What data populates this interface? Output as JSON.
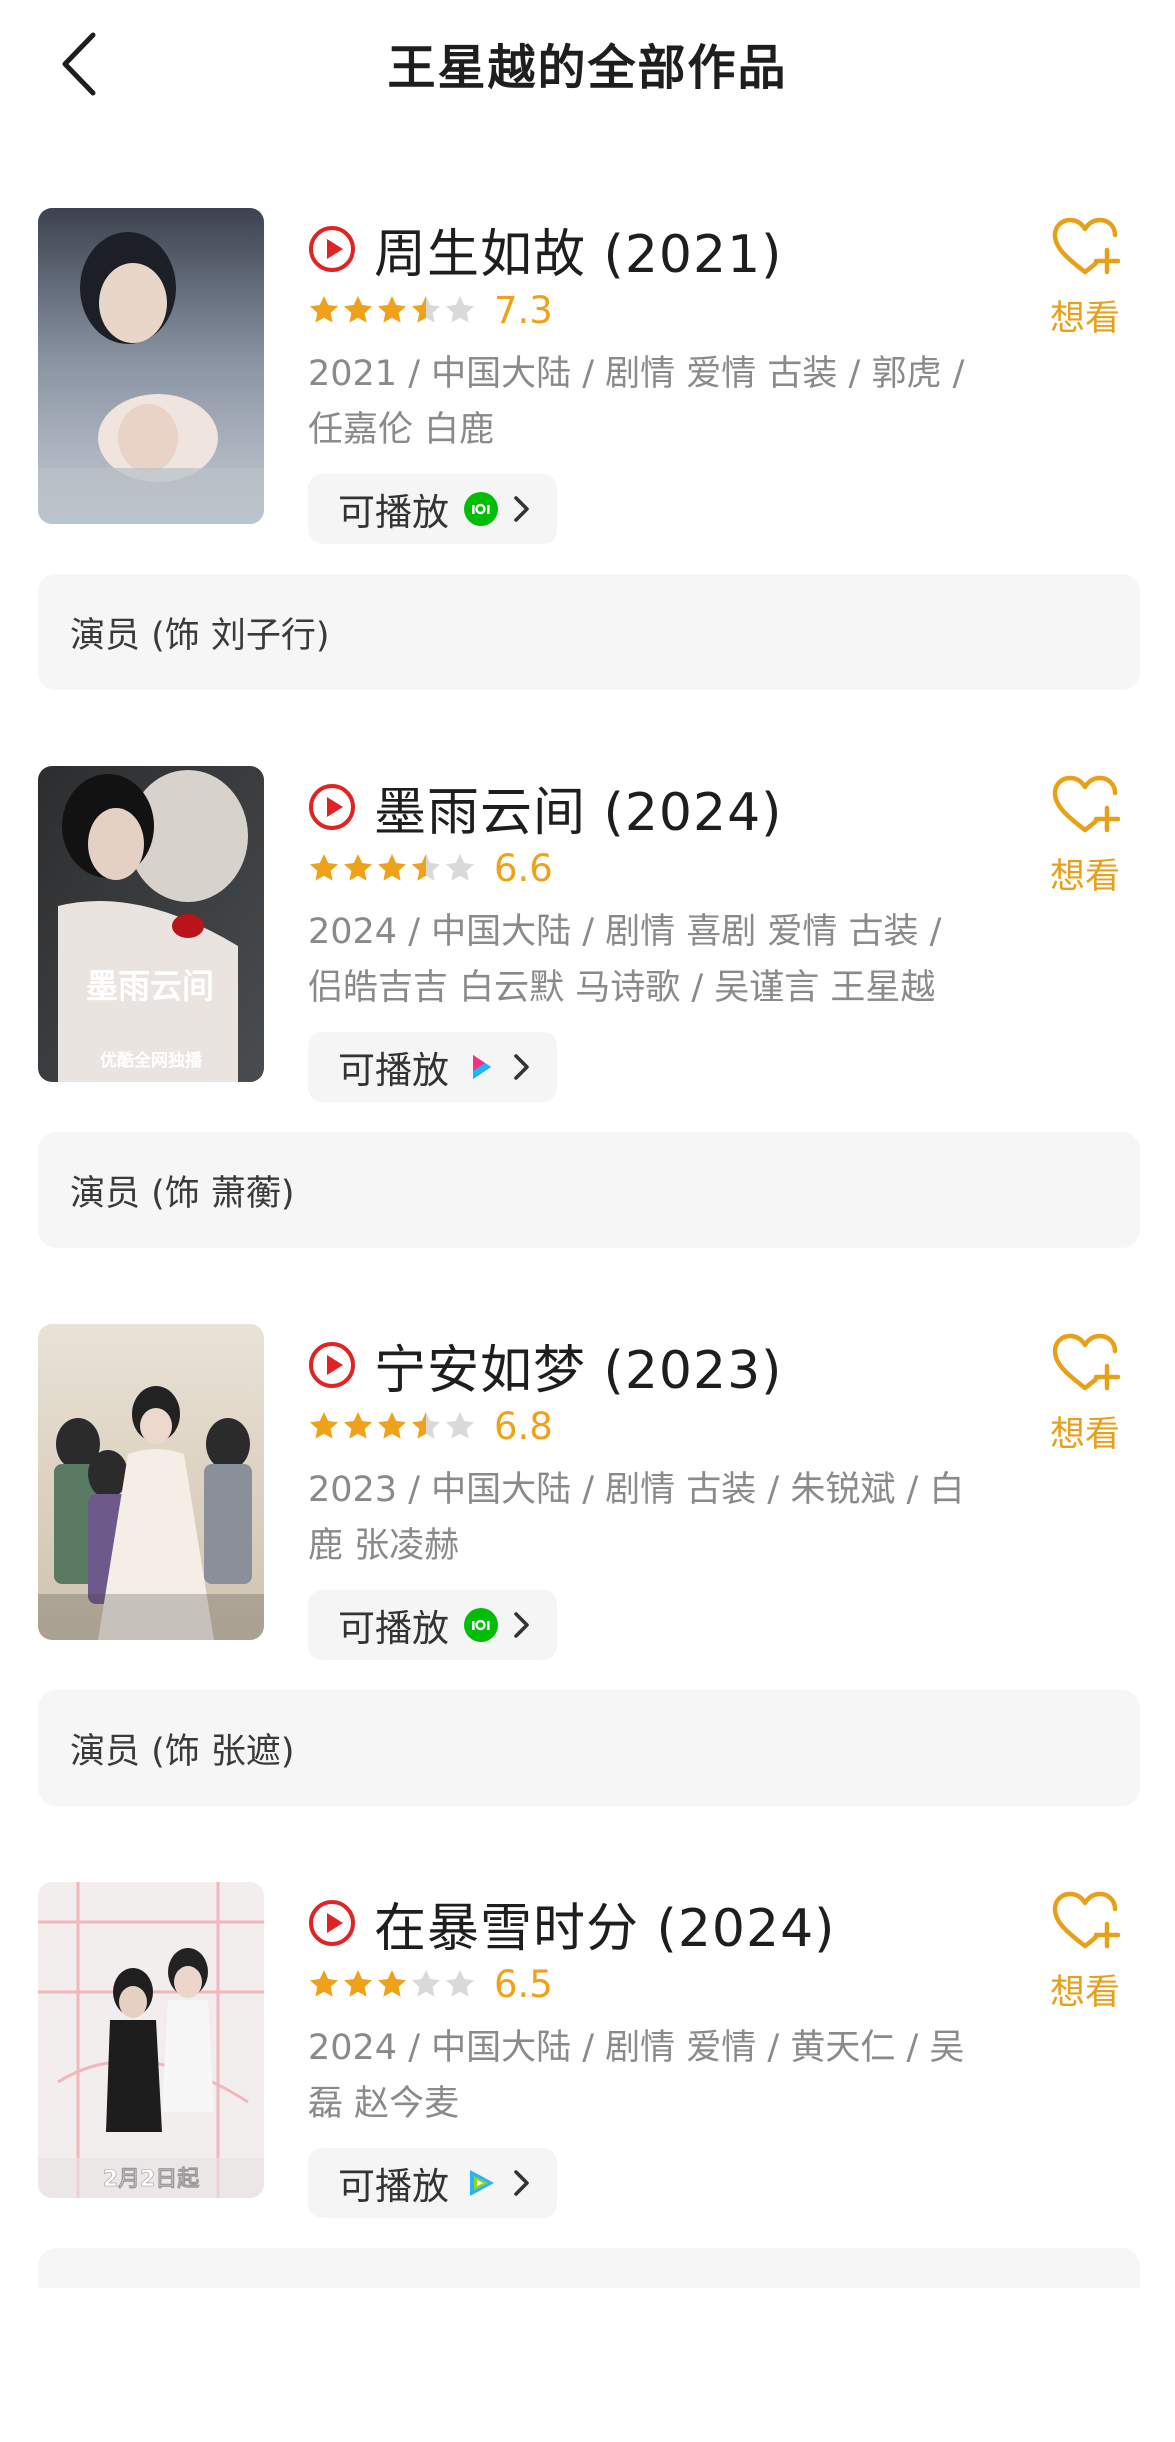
{
  "header": {
    "title": "王星越的全部作品",
    "back_icon": "chevron-left-icon"
  },
  "colors": {
    "accent_orange": "#f0a11a",
    "play_red": "#e02424",
    "star_gray": "#d9d9d9",
    "iqiyi_green": "#00be06"
  },
  "works": [
    {
      "title": "周生如故 (2021)",
      "rating": 7.3,
      "rating_text": "7.3",
      "stars": 3.5,
      "meta": "2021 / 中国大陆 / 剧情 爱情 古装 / 郭虎 / 任嘉伦 白鹿",
      "playable_label": "可播放",
      "platform_icon": "iqiyi-icon",
      "want_label": "想看",
      "role": "演员 (饰 刘子行)"
    },
    {
      "title": "墨雨云间 (2024)",
      "rating": 6.6,
      "rating_text": "6.6",
      "stars": 3.5,
      "meta": "2024 / 中国大陆 / 剧情 喜剧 爱情 古装 / 侣皓吉吉 白云默 马诗歌 / 吴谨言 王星越",
      "playable_label": "可播放",
      "platform_icon": "youku-icon",
      "want_label": "想看",
      "role": "演员 (饰 萧蘅)",
      "poster_text": "墨雨云间",
      "poster_caption": "优酷全网独播"
    },
    {
      "title": "宁安如梦 (2023)",
      "rating": 6.8,
      "rating_text": "6.8",
      "stars": 3.5,
      "meta": "2023 / 中国大陆 / 剧情 古装 / 朱锐斌 / 白鹿 张凌赫",
      "playable_label": "可播放",
      "platform_icon": "iqiyi-icon",
      "want_label": "想看",
      "role": "演员 (饰 张遮)"
    },
    {
      "title": "在暴雪时分 (2024)",
      "rating": 6.5,
      "rating_text": "6.5",
      "stars": 3,
      "meta": "2024 / 中国大陆 / 剧情 爱情 / 黄天仁 / 吴磊 赵今麦",
      "playable_label": "可播放",
      "platform_icon": "tencent-video-icon",
      "want_label": "想看",
      "role": "",
      "poster_caption": "2月2日起"
    }
  ]
}
